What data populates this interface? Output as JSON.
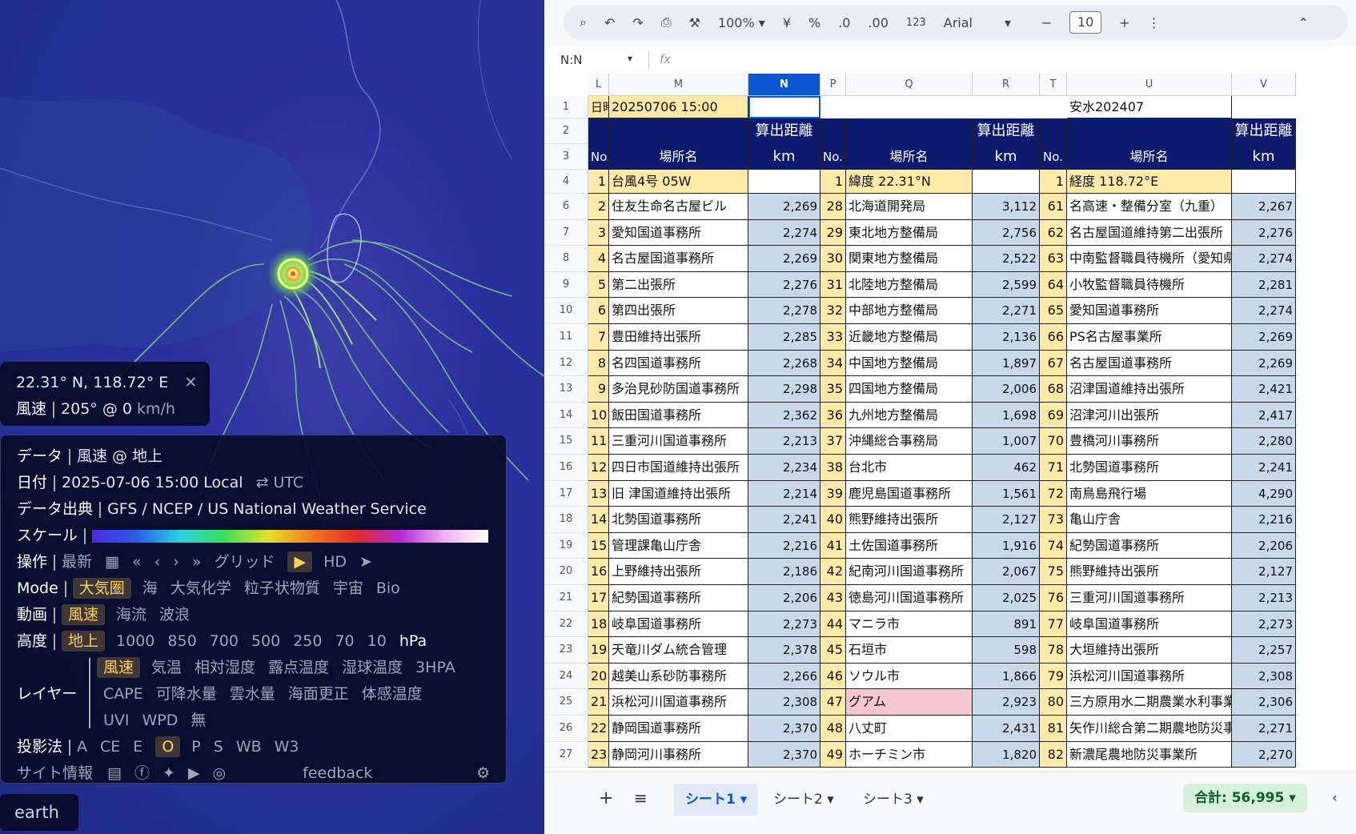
{
  "earth": {
    "coord": "22.31° N, 118.72° E",
    "close": "✕",
    "wind_label": "風速",
    "wind_value": "205° @ 0",
    "wind_unit": "km/h",
    "rows": {
      "data": {
        "label": "データ",
        "value": "風速 @ 地上"
      },
      "date": {
        "label": "日付",
        "value": "2025-07-06 15:00 Local",
        "alt": "⇄ UTC"
      },
      "source": {
        "label": "データ出典",
        "value": "GFS / NCEP / US National Weather Service"
      },
      "scale": {
        "label": "スケール"
      },
      "control": {
        "label": "操作",
        "latest": "最新",
        "grid": "グリッド",
        "hd": "HD"
      },
      "mode": {
        "label": "Mode",
        "items": [
          "大気圏",
          "海",
          "大気化学",
          "粒子状物質",
          "宇宙",
          "Bio"
        ]
      },
      "anim": {
        "label": "動画",
        "items": [
          "風速",
          "海流",
          "波浪"
        ]
      },
      "height": {
        "label": "高度",
        "items": [
          "地上",
          "1000",
          "850",
          "700",
          "500",
          "250",
          "70",
          "10"
        ],
        "unit": "hPa"
      },
      "layer": {
        "label": "レイヤー",
        "line1": [
          "風速",
          "気温",
          "相対湿度",
          "露点温度",
          "湿球温度",
          "3HPA"
        ],
        "line2": [
          "CAPE",
          "可降水量",
          "雲水量",
          "海面更正",
          "体感温度"
        ],
        "line3": [
          "UVI",
          "WPD",
          "無"
        ]
      },
      "proj": {
        "label": "投影法",
        "items": [
          "A",
          "CE",
          "E",
          "O",
          "P",
          "S",
          "WB",
          "W3"
        ]
      },
      "site": {
        "label": "サイト情報",
        "feedback": "feedback"
      }
    },
    "badge": "earth"
  },
  "sheet": {
    "toolbar": {
      "zoom": "100%",
      "yen": "¥",
      "pct": "%",
      "dec1": ".0",
      "dec2": ".00",
      "fmt": "123",
      "font": "Arial",
      "size": "10"
    },
    "namebox": "N:N",
    "fx": "fx",
    "columns": [
      "L",
      "M",
      "N",
      "P",
      "Q",
      "R",
      "T",
      "U",
      "V"
    ],
    "row1": {
      "l": "日時",
      "m": "20250706 15:00",
      "u": "安水202407"
    },
    "hdr": {
      "dist": "算出距離",
      "no": "No.",
      "place": "場所名",
      "km": "km"
    },
    "row4": [
      {
        "no": "1",
        "name": "台風4号 05W"
      },
      {
        "no": "1",
        "name": "緯度 22.31°N"
      },
      {
        "no": "1",
        "name": "経度 118.72°E"
      }
    ],
    "rownums": [
      "1",
      "2",
      "3",
      "4",
      "6",
      "7",
      "8",
      "9",
      "10",
      "11",
      "12",
      "13",
      "14",
      "15",
      "16",
      "17",
      "18",
      "19",
      "20",
      "21",
      "22",
      "23",
      "24",
      "25",
      "26",
      "27"
    ],
    "rows": [
      [
        [
          "2",
          "住友生命名古屋ビル",
          "2,269"
        ],
        [
          "28",
          "北海道開発局",
          "3,112"
        ],
        [
          "61",
          "名高速・整備分室（九重）",
          "2,267"
        ]
      ],
      [
        [
          "3",
          "愛知国道事務所",
          "2,274"
        ],
        [
          "29",
          "東北地方整備局",
          "2,756"
        ],
        [
          "62",
          "名古屋国道維持第二出張所",
          "2,276"
        ]
      ],
      [
        [
          "4",
          "名古屋国道事務所",
          "2,269"
        ],
        [
          "30",
          "関東地方整備局",
          "2,522"
        ],
        [
          "63",
          "中南監督職員待機所（愛知県",
          "2,274"
        ]
      ],
      [
        [
          "5",
          "第二出張所",
          "2,276"
        ],
        [
          "31",
          "北陸地方整備局",
          "2,599"
        ],
        [
          "64",
          "小牧監督職員待機所",
          "2,281"
        ]
      ],
      [
        [
          "6",
          "第四出張所",
          "2,278"
        ],
        [
          "32",
          "中部地方整備局",
          "2,271"
        ],
        [
          "65",
          "愛知国道事務所",
          "2,274"
        ]
      ],
      [
        [
          "7",
          "豊田維持出張所",
          "2,285"
        ],
        [
          "33",
          "近畿地方整備局",
          "2,136"
        ],
        [
          "66",
          "PS名古屋事業所",
          "2,269"
        ]
      ],
      [
        [
          "8",
          "名四国道事務所",
          "2,268"
        ],
        [
          "34",
          "中国地方整備局",
          "1,897"
        ],
        [
          "67",
          "名古屋国道事務所",
          "2,269"
        ]
      ],
      [
        [
          "9",
          "多治見砂防国道事務所",
          "2,298"
        ],
        [
          "35",
          "四国地方整備局",
          "2,006"
        ],
        [
          "68",
          "沼津国道維持出張所",
          "2,421"
        ]
      ],
      [
        [
          "10",
          "飯田国道事務所",
          "2,362"
        ],
        [
          "36",
          "九州地方整備局",
          "1,698"
        ],
        [
          "69",
          "沼津河川出張所",
          "2,417"
        ]
      ],
      [
        [
          "11",
          "三重河川国道事務所",
          "2,213"
        ],
        [
          "37",
          "沖縄総合事務局",
          "1,007"
        ],
        [
          "70",
          "豊橋河川事務所",
          "2,280"
        ]
      ],
      [
        [
          "12",
          "四日市国道維持出張所",
          "2,234"
        ],
        [
          "38",
          "台北市",
          "462"
        ],
        [
          "71",
          "北勢国道事務所",
          "2,241"
        ]
      ],
      [
        [
          "13",
          "旧 津国道維持出張所",
          "2,214"
        ],
        [
          "39",
          "鹿児島国道事務所",
          "1,561"
        ],
        [
          "72",
          "南鳥島飛行場",
          "4,290"
        ]
      ],
      [
        [
          "14",
          "北勢国道事務所",
          "2,241"
        ],
        [
          "40",
          "熊野維持出張所",
          "2,127"
        ],
        [
          "73",
          "亀山庁舎",
          "2,216"
        ]
      ],
      [
        [
          "15",
          "管理課亀山庁舎",
          "2,216"
        ],
        [
          "41",
          "土佐国道事務所",
          "1,916"
        ],
        [
          "74",
          "紀勢国道事務所",
          "2,206"
        ]
      ],
      [
        [
          "16",
          "上野維持出張所",
          "2,186"
        ],
        [
          "42",
          "紀南河川国道事務所",
          "2,067"
        ],
        [
          "75",
          "熊野維持出張所",
          "2,127"
        ]
      ],
      [
        [
          "17",
          "紀勢国道事務所",
          "2,206"
        ],
        [
          "43",
          "徳島河川国道事務所",
          "2,025"
        ],
        [
          "76",
          "三重河川国道事務所",
          "2,213"
        ]
      ],
      [
        [
          "18",
          "岐阜国道事務所",
          "2,273"
        ],
        [
          "44",
          "マニラ市",
          "891"
        ],
        [
          "77",
          "岐阜国道事務所",
          "2,273"
        ]
      ],
      [
        [
          "19",
          "天竜川ダム統合管理",
          "2,378"
        ],
        [
          "45",
          "石垣市",
          "598"
        ],
        [
          "78",
          "大垣維持出張所",
          "2,257"
        ]
      ],
      [
        [
          "20",
          "越美山系砂防事務所",
          "2,266"
        ],
        [
          "46",
          "ソウル市",
          "1,866"
        ],
        [
          "79",
          "浜松河川国道事務所",
          "2,308"
        ]
      ],
      [
        [
          "21",
          "浜松河川国道事務所",
          "2,308"
        ],
        [
          "47",
          "グアム",
          "2,923"
        ],
        [
          "80",
          "三方原用水二期農業水利事業",
          "2,306"
        ]
      ],
      [
        [
          "22",
          "静岡国道事務所",
          "2,370"
        ],
        [
          "48",
          "八丈町",
          "2,431"
        ],
        [
          "81",
          "矢作川総合第二期農地防災事",
          "2,271"
        ]
      ],
      [
        [
          "23",
          "静岡河川事務所",
          "2,370"
        ],
        [
          "49",
          "ホーチミン市",
          "1,820"
        ],
        [
          "82",
          "新濃尾農地防災事業所",
          "2,270"
        ]
      ]
    ],
    "tabs": [
      "シート1",
      "シート2",
      "シート3"
    ],
    "sum": "合計: 56,995"
  }
}
